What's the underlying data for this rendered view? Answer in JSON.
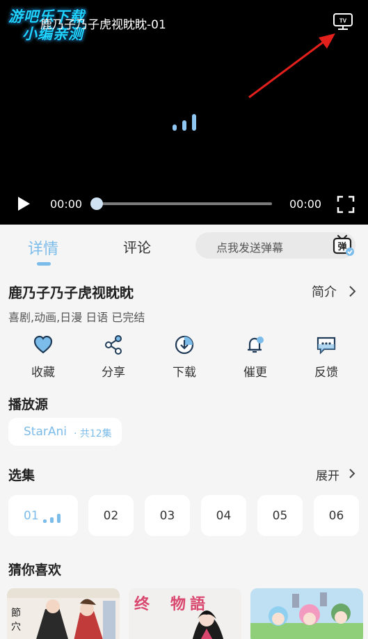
{
  "watermark": {
    "line1": "游吧乐下载",
    "line2": "小编亲测"
  },
  "player": {
    "title": "鹿乃子乃子虎视眈眈-01",
    "current_time": "00:00",
    "total_time": "00:00",
    "progress": 0.0
  },
  "tabs": [
    {
      "label": "详情"
    },
    {
      "label": "评论"
    }
  ],
  "danmu": {
    "placeholder": "点我发送弹幕",
    "badge": "弹"
  },
  "show": {
    "title": "鹿乃子乃子虎视眈眈",
    "intro_link": "简介",
    "meta": "喜剧,动画,日漫 日语 已完结"
  },
  "actions": [
    {
      "label": "收藏",
      "icon": "heart-icon"
    },
    {
      "label": "分享",
      "icon": "share-icon"
    },
    {
      "label": "下载",
      "icon": "download-icon"
    },
    {
      "label": "催更",
      "icon": "bell-icon"
    },
    {
      "label": "反馈",
      "icon": "feedback-icon"
    }
  ],
  "source": {
    "section_title": "播放源",
    "name": "StarAni",
    "count": "· 共12集"
  },
  "episodes": {
    "section_title": "选集",
    "expand_label": "展开",
    "items": [
      "01",
      "02",
      "03",
      "04",
      "05",
      "06"
    ],
    "active_index": 0
  },
  "recommend": {
    "section_title": "猜你喜欢"
  },
  "colors": {
    "accent": "#7cbcea",
    "background": "#f5f5f5",
    "player_bg": "#000000",
    "annotation_arrow": "#e3201b"
  }
}
